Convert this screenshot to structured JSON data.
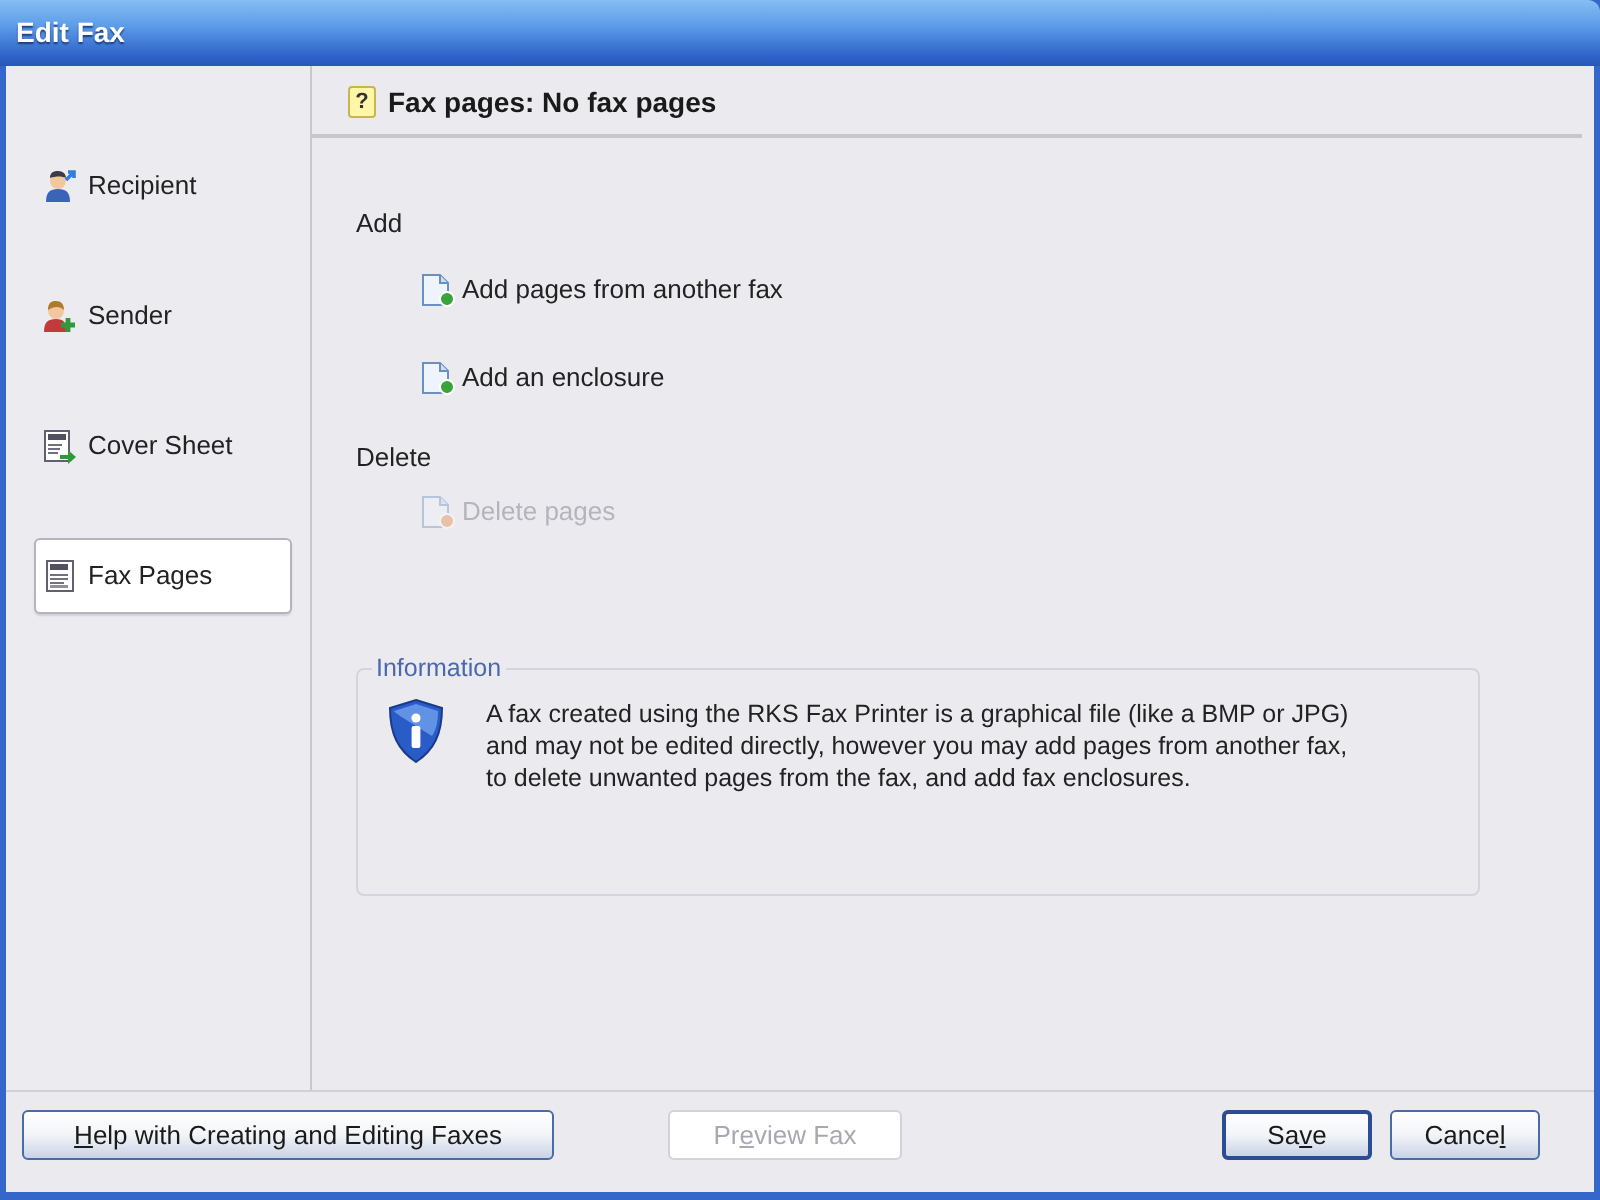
{
  "window": {
    "title": "Edit Fax"
  },
  "sidebar": {
    "items": [
      {
        "label": "Recipient",
        "selected": false
      },
      {
        "label": "Sender",
        "selected": false
      },
      {
        "label": "Cover Sheet",
        "selected": false
      },
      {
        "label": "Fax Pages",
        "selected": true
      }
    ]
  },
  "header": {
    "badge": "?",
    "title": "Fax pages: No fax pages"
  },
  "sections": [
    {
      "title": "Add",
      "actions": [
        {
          "label": "Add pages from another fax",
          "disabled": false
        },
        {
          "label": "Add an enclosure",
          "disabled": false
        }
      ]
    },
    {
      "title": "Delete",
      "actions": [
        {
          "label": "Delete pages",
          "disabled": true
        }
      ]
    }
  ],
  "info": {
    "legend": "Information",
    "text": "A fax created using the RKS Fax Printer is a graphical file (like a BMP or JPG) and may not be edited directly, however you may add pages from another fax, to delete unwanted pages from the fax, and add fax enclosures."
  },
  "buttons": [
    {
      "access_key": "H",
      "label_end": "elp with Creating and Editing Faxes",
      "disabled": false,
      "default": false
    },
    {
      "label_start": "Pr",
      "access_key": "e",
      "label_end": "view Fax",
      "disabled": true,
      "default": false
    },
    {
      "label_start": "Sa",
      "access_key": "v",
      "label_end": "e",
      "disabled": false,
      "default": true
    },
    {
      "label_start": "Cance",
      "access_key": "l",
      "disabled": false,
      "default": false
    }
  ]
}
